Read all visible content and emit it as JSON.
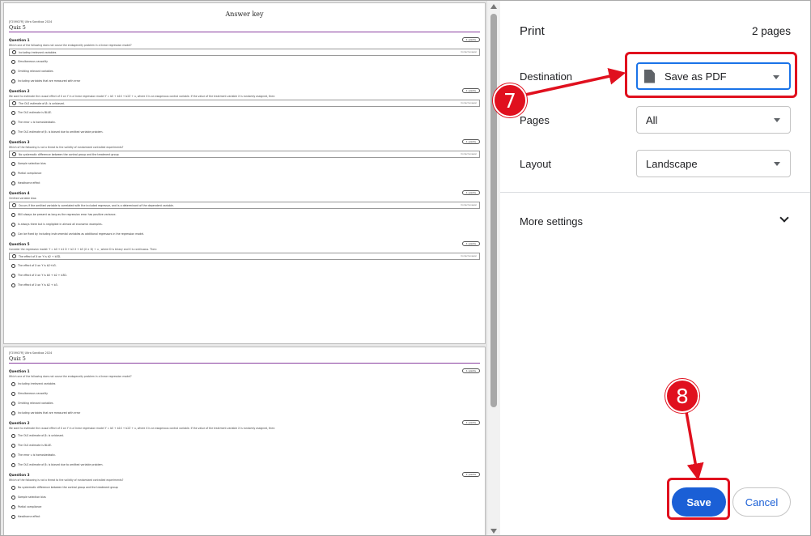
{
  "preview": {
    "doc_title": "Answer key",
    "course": "[F25M07R] Ultra Sandbox 2024",
    "quiz_title": "Quiz 5",
    "page1_questions": [
      {
        "label": "Question 1",
        "points": "1 points",
        "text": "Which one of the following does not cause the endogeneity problem in a linear regression model?",
        "options": [
          {
            "text": "Including irrelevant variables",
            "correct": true
          },
          {
            "text": "Simultaneous causality",
            "correct": false
          },
          {
            "text": "Omitting relevant variables",
            "correct": false
          },
          {
            "text": "Including variables that are measured with error",
            "correct": false
          }
        ]
      },
      {
        "label": "Question 2",
        "points": "1 points",
        "text": "We want to estimate the causal effect of X on Y in a linear regression model Y = b0 + b1X + b2Z + u, where X is an exogenous control variable. If the value of the treatment variable X is randomly assigned, then:",
        "options": [
          {
            "text": "The OLS estimate of β₁ is unbiased.",
            "correct": true
          },
          {
            "text": "The OLS estimate is BLUE.",
            "correct": false
          },
          {
            "text": "The error u is homoskedastic.",
            "correct": false
          },
          {
            "text": "The OLS estimate of β₁ is biased due to omitted variable problem.",
            "correct": false
          }
        ]
      },
      {
        "label": "Question 3",
        "points": "1 points",
        "text": "Which of the following is not a threat to the validity of randomized controlled experiments?",
        "options": [
          {
            "text": "No systematic difference between the control group and the treatment group",
            "correct": true
          },
          {
            "text": "Sample selection bias",
            "correct": false
          },
          {
            "text": "Partial compliance",
            "correct": false
          },
          {
            "text": "Hawthorne effect",
            "correct": false
          }
        ]
      },
      {
        "label": "Question 4",
        "points": "1 points",
        "text": "Omitted variable bias:",
        "options": [
          {
            "text": "Occurs if the omitted variable is correlated with the included regressor, and is a determinant of the dependent variable.",
            "correct": true
          },
          {
            "text": "Will always be present as long as the regression error has positive variance.",
            "correct": false
          },
          {
            "text": "Is always there but is negligible in almost all economic examples.",
            "correct": false
          },
          {
            "text": "Can be fixed by including instrumental variables as additional regressors in the regression model.",
            "correct": false
          }
        ]
      },
      {
        "label": "Question 5",
        "points": "1 points",
        "text": "Consider the regression model: Y = b0 + b1 D + b2 X + b3 (X × D) + u , where D is binary and X is continuous. Then:",
        "options": [
          {
            "text": "The effect of X on Y is b2 + b3D.",
            "correct": true
          },
          {
            "text": "The effect of X on Y is b2+b3.",
            "correct": false
          },
          {
            "text": "The effect of X on Y is b0 + b2 + b3D.",
            "correct": false
          },
          {
            "text": "The effect of X on Y is b2 + b3.",
            "correct": false
          }
        ]
      }
    ],
    "page2_questions": [
      {
        "label": "Question 1",
        "points": "1 points",
        "text": "Which one of the following does not cause the endogeneity problem in a linear regression model?",
        "options": [
          {
            "text": "Including irrelevant variables"
          },
          {
            "text": "Simultaneous causality"
          },
          {
            "text": "Omitting relevant variables"
          },
          {
            "text": "Including variables that are measured with error"
          }
        ]
      },
      {
        "label": "Question 2",
        "points": "1 points",
        "text": "We want to estimate the causal effect of X on Y in a linear regression model Y = b0 + b1X + b2Z + u, where X is an exogenous control variable. If the value of the treatment variable X is randomly assigned, then:",
        "options": [
          {
            "text": "The OLS estimate of β₁ is unbiased."
          },
          {
            "text": "The OLS estimate is BLUE."
          },
          {
            "text": "The error u is homoskedastic."
          },
          {
            "text": "The OLS estimate of β₁ is biased due to omitted variable problem."
          }
        ]
      },
      {
        "label": "Question 3",
        "points": "1 points",
        "text": "Which of the following is not a threat to the validity of randomized controlled experiments?",
        "options": [
          {
            "text": "No systematic difference between the control group and the treatment group"
          },
          {
            "text": "Sample selection bias"
          },
          {
            "text": "Partial compliance"
          },
          {
            "text": "Hawthorne effect"
          }
        ]
      }
    ],
    "correct_label": "Correct answer"
  },
  "panel": {
    "title": "Print",
    "page_count": "2 pages",
    "destination_label": "Destination",
    "destination_value": "Save as PDF",
    "pages_label": "Pages",
    "pages_value": "All",
    "layout_label": "Layout",
    "layout_value": "Landscape",
    "more_settings": "More settings",
    "save": "Save",
    "cancel": "Cancel"
  },
  "annotations": {
    "badge_7": "7",
    "badge_8": "8",
    "highlight_color": "#e0101e"
  },
  "colors": {
    "accent": "#1a5fd6",
    "quiz_rule": "#8a3fa0"
  },
  "icons": [
    "pdf-file-icon",
    "caret-down-icon",
    "chevron-down-icon",
    "scroll-up-icon",
    "scroll-down-icon"
  ]
}
